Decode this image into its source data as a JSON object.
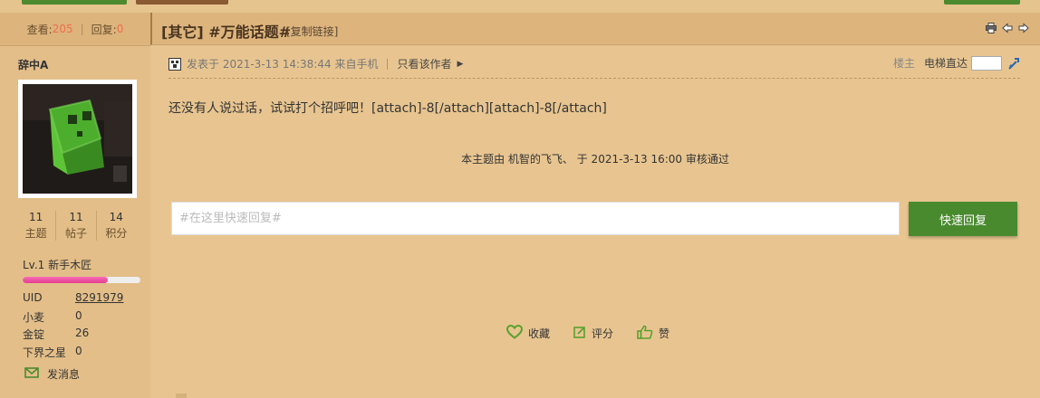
{
  "header": {
    "views_label": "查看:",
    "views_value": "205",
    "replies_label": "回复:",
    "replies_value": "0",
    "title": "[其它] #万能话题#",
    "copy_link": "[复制链接]"
  },
  "author": {
    "name": "辞中A",
    "stats": [
      {
        "value": "11",
        "label": "主题"
      },
      {
        "value": "11",
        "label": "帖子"
      },
      {
        "value": "14",
        "label": "积分"
      }
    ],
    "level": "Lv.1 新手木匠",
    "level_progress": 0.72,
    "info": [
      {
        "key": "UID",
        "value": "8291979"
      },
      {
        "key": "小麦",
        "value": "0"
      },
      {
        "key": "金锭",
        "value": "26"
      },
      {
        "key": "下界之星",
        "value": "0"
      }
    ],
    "send_message": "发消息"
  },
  "post": {
    "meta": "发表于 2021-3-13 14:38:44 来自手机",
    "author_only": "只看该作者",
    "floor": "楼主",
    "jump_label": "电梯直达",
    "content": "还没有人说过话，试试打个招呼吧！[attach]-8[/attach][attach]-8[/attach]",
    "audit": "本主题由 机智的飞飞、 于 2021-3-13 16:00 审核通过"
  },
  "reply": {
    "placeholder": "#在这里快速回复#",
    "button": "快速回复"
  },
  "actions": {
    "favorite": "收藏",
    "rate": "评分",
    "like": "赞"
  },
  "colors": {
    "accent_green": "#4a8a2f",
    "count_orange": "#f26c4f",
    "level_pink": "#e33d8f"
  }
}
